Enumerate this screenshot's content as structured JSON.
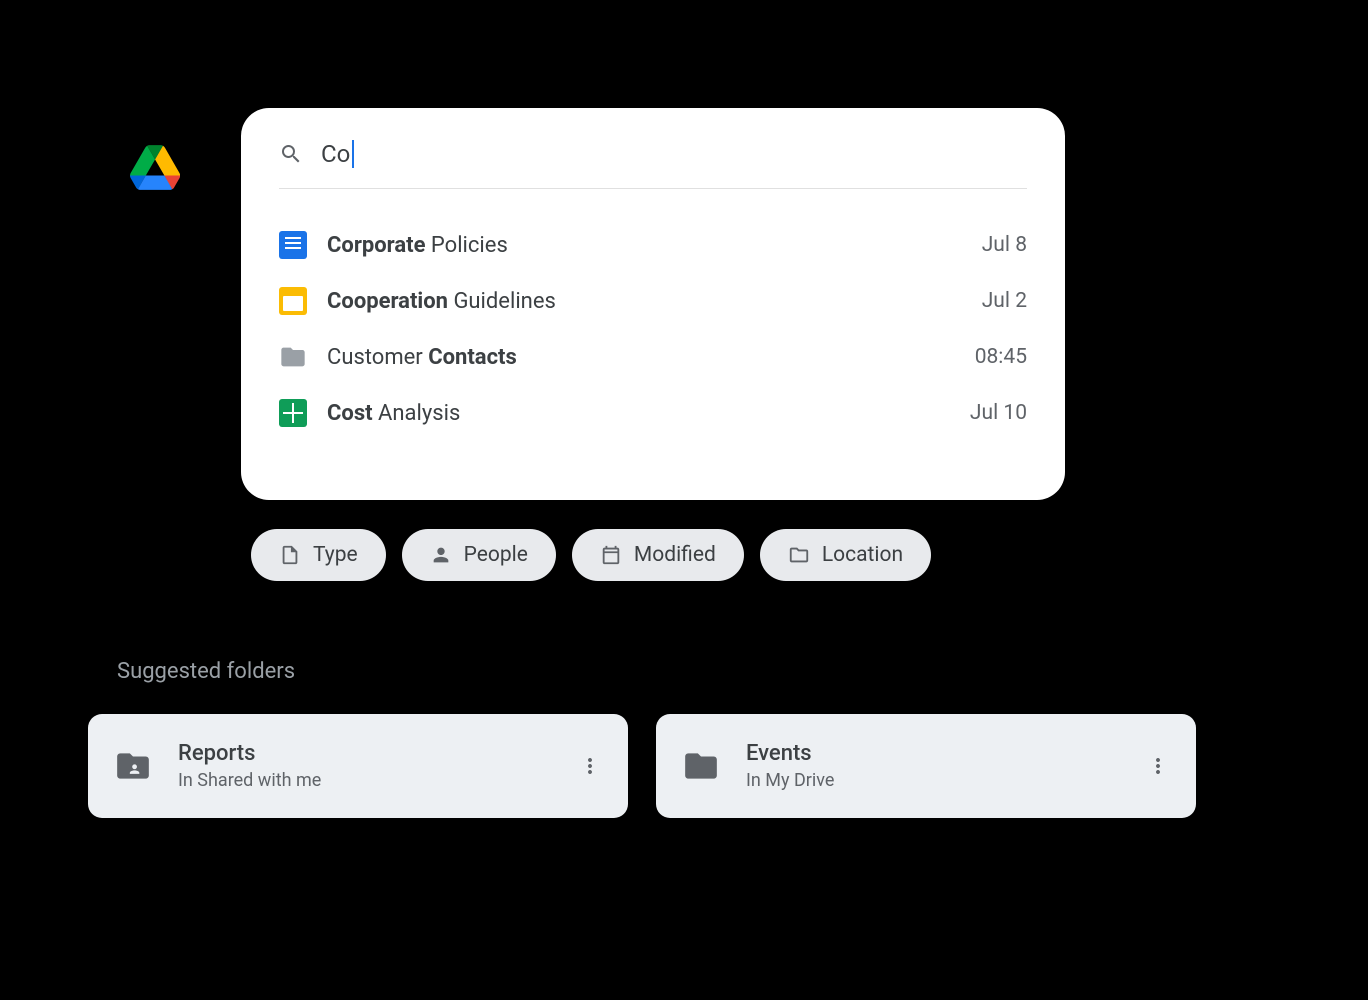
{
  "search": {
    "query": "Co"
  },
  "results": [
    {
      "icon": "docs",
      "name_bold": "Corporate",
      "name_rest": " Policies",
      "bold_first": true,
      "date": "Jul 8"
    },
    {
      "icon": "slides",
      "name_bold": "Cooperation",
      "name_rest": " Guidelines",
      "bold_first": true,
      "date": "Jul 2"
    },
    {
      "icon": "folder",
      "name_bold": "Contacts",
      "name_rest": "Customer ",
      "bold_first": false,
      "date": "08:45"
    },
    {
      "icon": "sheets",
      "name_bold": "Cost",
      "name_rest": " Analysis",
      "bold_first": true,
      "date": "Jul 10"
    }
  ],
  "chips": [
    {
      "icon": "file",
      "label": "Type"
    },
    {
      "icon": "person",
      "label": "People"
    },
    {
      "icon": "calendar",
      "label": "Modified"
    },
    {
      "icon": "folder",
      "label": "Location"
    }
  ],
  "suggested_title": "Suggested folders",
  "folders": [
    {
      "icon": "shared-folder",
      "title": "Reports",
      "subtitle": "In Shared with me"
    },
    {
      "icon": "folder",
      "title": "Events",
      "subtitle": "In My Drive"
    }
  ]
}
